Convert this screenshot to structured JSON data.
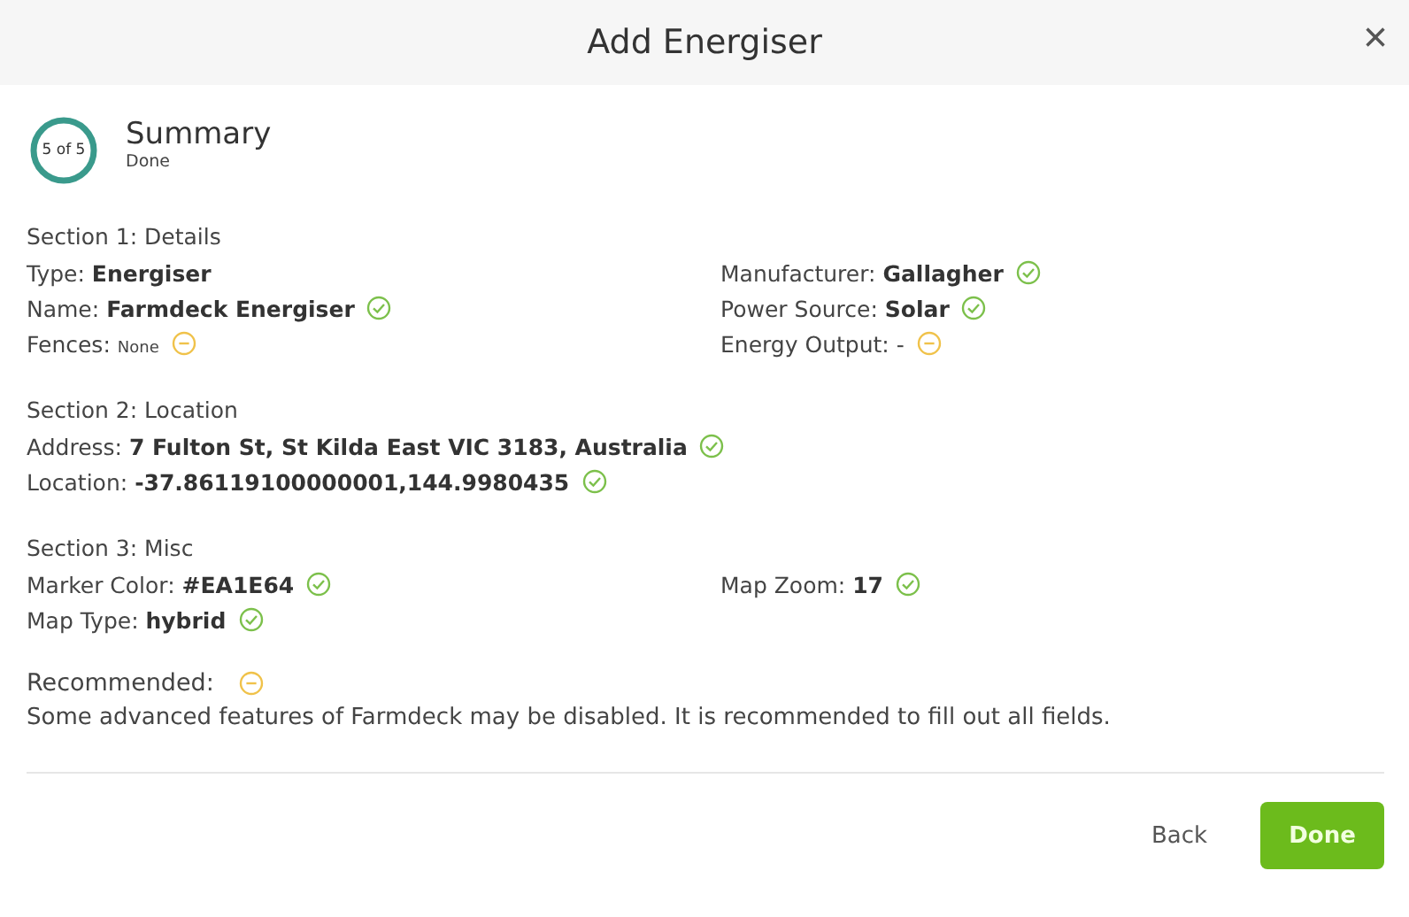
{
  "dialog": {
    "title": "Add Energiser",
    "close": "×"
  },
  "step": {
    "counter": "5 of 5",
    "title": "Summary",
    "subtitle": "Done"
  },
  "sections": [
    {
      "heading": "Section 1: Details",
      "left": [
        {
          "label": "Type:",
          "value": "Energiser",
          "kind": "bold"
        },
        {
          "label": "Name:",
          "value": "Farmdeck Energiser",
          "kind": "bold",
          "complete": true
        },
        {
          "label": "Fences:",
          "value": "None",
          "kind": "small",
          "complete": false
        }
      ],
      "right": [
        {
          "label": "Manufacturer:",
          "value": "Gallagher",
          "kind": "bold",
          "complete": true
        },
        {
          "label": "Power Source:",
          "value": "Solar",
          "kind": "bold",
          "complete": true
        },
        {
          "label": "Energy Output:",
          "value": "-",
          "kind": "plain",
          "complete": false
        }
      ]
    },
    {
      "heading": "Section 2: Location",
      "left": [
        {
          "label": "Address:",
          "value": "7 Fulton St, St Kilda East VIC 3183, Australia",
          "kind": "bold",
          "complete": true
        },
        {
          "label": "Location:",
          "value": "-37.86119100000001,144.9980435",
          "kind": "bold",
          "complete": true
        }
      ]
    },
    {
      "heading": "Section 3: Misc",
      "left": [
        {
          "label": "Marker Color:",
          "value": "#EA1E64",
          "kind": "bold",
          "complete": true
        },
        {
          "label": "Map Type:",
          "value": "hybrid",
          "kind": "bold",
          "complete": true
        }
      ],
      "right": [
        {
          "label": "Map Zoom:",
          "value": "17",
          "kind": "bold",
          "complete": true
        }
      ]
    }
  ],
  "recommended": {
    "heading": "Recommended:",
    "complete": false,
    "text": "Some advanced features of Farmdeck may be disabled. It is recommended to fill out all fields."
  },
  "buttons": [
    {
      "label": "Back",
      "kind": "text"
    },
    {
      "label": "Done",
      "kind": "primary"
    }
  ]
}
